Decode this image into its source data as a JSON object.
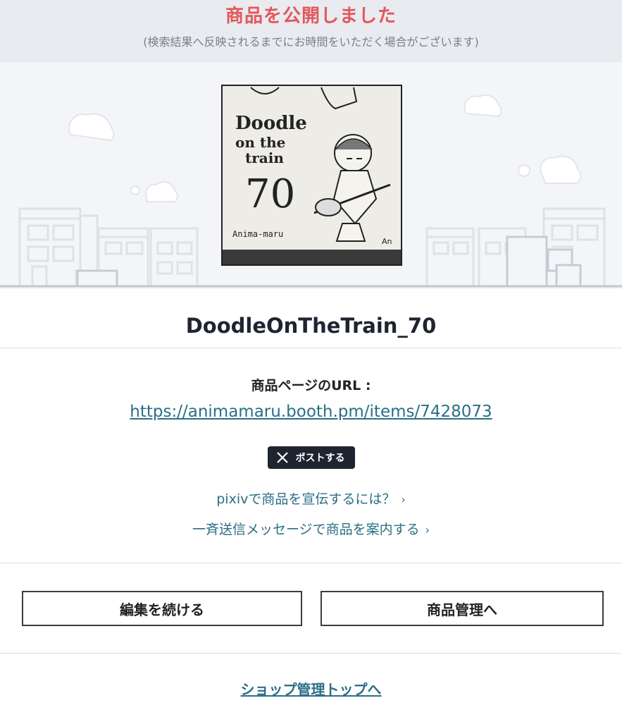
{
  "notice": {
    "title": "商品を公開しました",
    "subtitle": "(検索結果へ反映されるまでにお時間をいただく場合がございます)"
  },
  "thumbnail": {
    "lines": [
      "Doodle",
      "on the",
      "train",
      "70"
    ],
    "signature": "Anima-maru",
    "signature_right": "An"
  },
  "item": {
    "title": "DoodleOnTheTrain_70"
  },
  "url": {
    "label": "商品ページのURL :",
    "value": "https://animamaru.booth.pm/items/7428073"
  },
  "share": {
    "post_label": "ポストする"
  },
  "promo": {
    "pixiv": "pixivで商品を宣伝するには？",
    "broadcast": "一斉送信メッセージで商品を案内する",
    "chevron": "›"
  },
  "actions": {
    "continue_edit": "編集を続ける",
    "manage_items": "商品管理へ"
  },
  "footer": {
    "shop_top": "ショップ管理トップへ"
  },
  "colors": {
    "accent_red": "#e2585b",
    "link_teal": "#2a6f86",
    "dark_button": "#1e2430"
  },
  "icons": {
    "x_logo": "x-logo-icon",
    "chevron": "chevron-right-icon"
  }
}
